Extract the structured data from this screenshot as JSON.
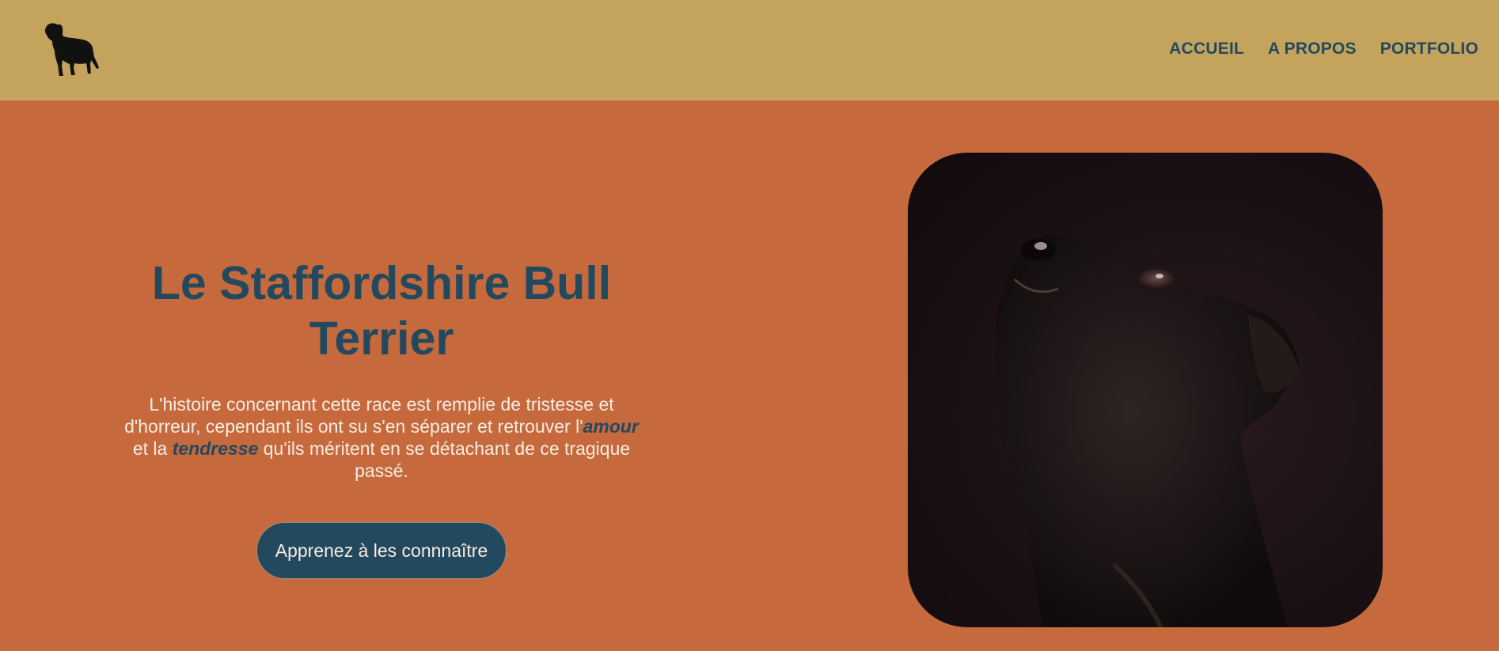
{
  "header": {
    "logo_icon": "staffordshire-dog-silhouette-icon",
    "background": "#c4a45c",
    "nav": [
      {
        "label": "ACCUEIL"
      },
      {
        "label": "A PROPOS"
      },
      {
        "label": "PORTFOLIO"
      }
    ]
  },
  "hero": {
    "background": "#c66a3d",
    "title": "Le Staffordshire Bull Terrier",
    "text_before": "L'histoire concernant cette race est remplie de tristesse et d'horreur, cependant ils ont su s'en séparer et retrouver l'",
    "emphasis_1": "amour",
    "text_middle": " et la ",
    "emphasis_2": "tendresse",
    "text_after": " qu'ils méritent en se détachant de ce tragique passé.",
    "cta_label": "Apprenez à les connnaître",
    "image_icon": "dog-portrait-photo",
    "accent": "#23495e"
  }
}
